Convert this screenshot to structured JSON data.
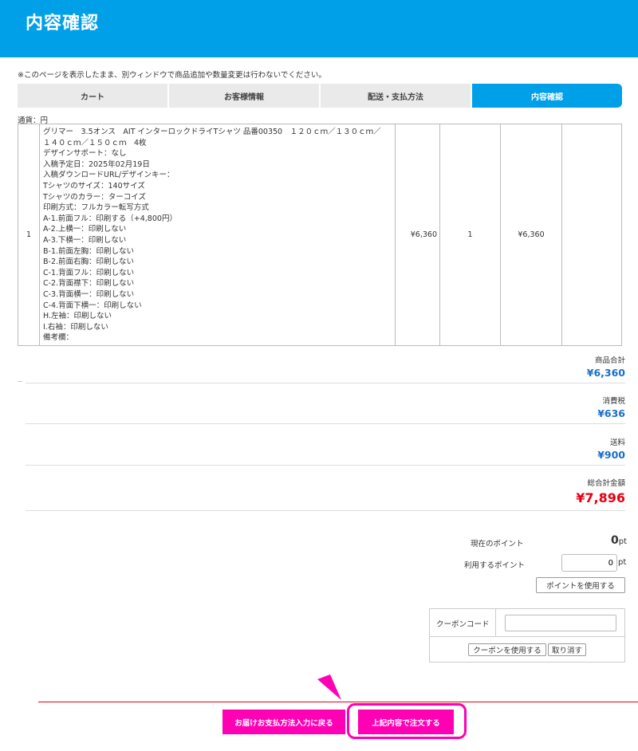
{
  "header": {
    "title": "内容確認"
  },
  "notice": "※このページを表示したまま、別ウィンドウで商品追加や数量変更は行わないでください。",
  "steps": [
    "カート",
    "お客様情報",
    "配送・支払方法",
    "内容確認"
  ],
  "currency_note": "通貨：円",
  "order": {
    "row_no": "1",
    "description_lines": [
      "グリマー　3.5オンス　AIT インターロックドライTシャツ 品番00350　１２０ｃｍ／１３０ｃｍ／",
      "１４０ｃｍ／１５０ｃｍ　4枚",
      "デザインサポート：なし",
      "入稿予定日：2025年02月19日",
      "入稿ダウンロードURL/デザインキー：",
      "Tシャツのサイズ：140サイズ",
      "Tシャツのカラー：ターコイズ",
      "印刷方式：フルカラー転写方式",
      "A-1.前面フル：印刷する（+4,800円）",
      "A-2.上横一：印刷しない",
      "A-3.下横一：印刷しない",
      "B-1.前面左胸：印刷しない",
      "B-2.前面右胸：印刷しない",
      "C-1.背面フル：印刷しない",
      "C-2.背面襟下：印刷しない",
      "C-3.背面横一：印刷しない",
      "C-4.背面下横一：印刷しない",
      "H.左袖：印刷しない",
      "I.右袖：印刷しない",
      "備考欄："
    ],
    "unit_price": "¥6,360",
    "quantity": "1",
    "subtotal": "¥6,360",
    "action": ""
  },
  "summary": {
    "product_total_label": "商品合計",
    "product_total": "¥6,360",
    "tax_label": "消費税",
    "tax": "¥636",
    "shipping_label": "送料",
    "shipping": "¥900",
    "grand_total_label": "総合計金額",
    "grand_total": "¥7,896"
  },
  "points": {
    "current_label": "現在のポイント",
    "current_value": "0",
    "unit": "pt",
    "use_label": "利用するポイント",
    "use_value": "0",
    "use_button": "ポイントを使用する"
  },
  "coupon": {
    "label": "クーポンコード",
    "value": "",
    "use_button": "クーポンを使用する",
    "cancel_button": "取り消す"
  },
  "buttons": {
    "back": "お届けお支払方法入力に戻る",
    "order": "上記内容で注文する"
  },
  "colors": {
    "brand": "#00a0e9",
    "accent": "#ff00b4",
    "total": "#e60012",
    "price": "#1a6fc9"
  }
}
